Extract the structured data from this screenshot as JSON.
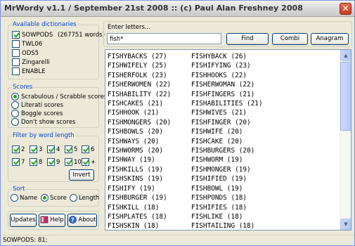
{
  "window": {
    "title": "MrWordy v1.1 / September 21st 2008 :: (c) Paul Alan Freshney 2008"
  },
  "dictionaries": {
    "group_title": "Available dictionaries",
    "items": [
      {
        "label": "SOWPODS",
        "count": "(267751 words)",
        "checked": true
      },
      {
        "label": "TWL06",
        "checked": false
      },
      {
        "label": "ODS5",
        "checked": false
      },
      {
        "label": "Zingarelli",
        "checked": false
      },
      {
        "label": "ENABLE",
        "checked": false
      }
    ]
  },
  "scores": {
    "group_title": "Scores",
    "options": [
      {
        "label": "Scrabulous / Scrabble scores",
        "selected": true
      },
      {
        "label": "Literati scores",
        "selected": false
      },
      {
        "label": "Boggle scores",
        "selected": false
      },
      {
        "label": "Don't show scores",
        "selected": false
      }
    ]
  },
  "word_length": {
    "group_title": "Filter by word length",
    "items": [
      "2",
      "3",
      "4",
      "5",
      "6",
      "7",
      "8",
      "9",
      "10",
      "+"
    ],
    "invert_label": "Invert"
  },
  "sort": {
    "group_title": "Sort",
    "options": [
      {
        "label": "Name",
        "selected": false
      },
      {
        "label": "Score",
        "selected": true
      },
      {
        "label": "Length",
        "selected": false
      }
    ]
  },
  "bottom_buttons": {
    "updates": "Updates",
    "help": "Help",
    "about": "About"
  },
  "search": {
    "label": "Enter letters...",
    "value": "fish*",
    "find": "Find",
    "combi": "Combi",
    "anagram": "Anagram"
  },
  "results": {
    "left": [
      "FISHYBACKS (27)",
      "FISHWIFELY (25)",
      "FISHERFOLK (23)",
      "FISHERWOMEN (22)",
      "FISHABILITY (22)",
      "FISHCAKES (21)",
      "FISHHOOK (21)",
      "FISHMONGERS (20)",
      "FISHBOWLS (20)",
      "FISHWAYS (20)",
      "FISHWORMS (20)",
      "FISHWAY (19)",
      "FISHKILLS (19)",
      "FISHSKINS (19)",
      "FISHIFY (19)",
      "FISHBURGER (19)",
      "FISHKILL (18)",
      "FISHPLATES (18)",
      "FISHSKIN (18)"
    ],
    "right": [
      "FISHYBACK (26)",
      "FISHIFYING (23)",
      "FISHHOOKS (22)",
      "FISHERWOMAN (22)",
      "FISHFINGERS (21)",
      "FISHABILITIES (21)",
      "FISHWIVES (21)",
      "FISHFINGER (20)",
      "FISHWIFE (20)",
      "FISHCAKE (20)",
      "FISHBURGERS (20)",
      "FISHWORM (19)",
      "FISHMONGER (19)",
      "FISHIFIED (19)",
      "FISHBOWL (19)",
      "FISHPONDS (18)",
      "FISHIFIES (18)",
      "FISHLIKE (18)",
      "FISHTAILING (18)"
    ]
  },
  "status": {
    "text": "SOWPODS: 81;"
  }
}
